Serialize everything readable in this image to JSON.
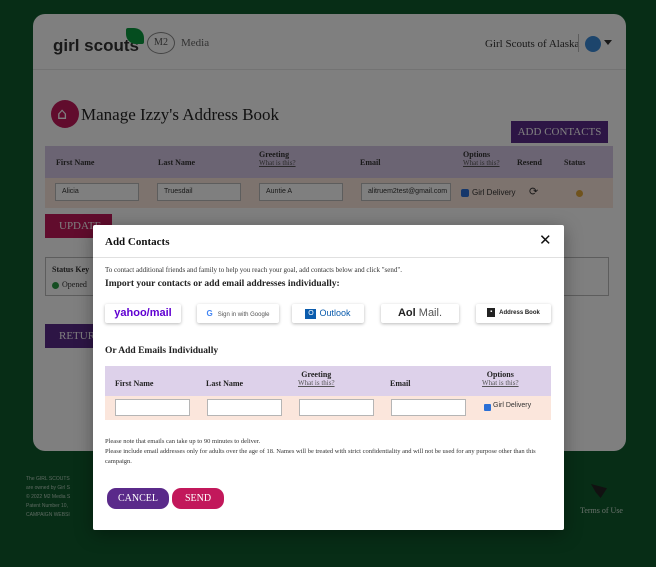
{
  "header": {
    "logo_text": "girl scouts",
    "m2_badge": "M2",
    "m2_label": "Media",
    "council": "Girl Scouts of Alaska"
  },
  "page": {
    "title": "Manage Izzy's Address Book",
    "add_contacts_label": "ADD CONTACTS",
    "update_label": "UPDATE",
    "return_label": "RETURN",
    "status_key_label": "Status Key",
    "status_opened_label": "Opened",
    "columns": {
      "first_name": "First Name",
      "last_name": "Last Name",
      "greeting": "Greeting",
      "greeting_link": "What is this?",
      "email": "Email",
      "options": "Options",
      "options_link": "What is this?",
      "resend": "Resend",
      "status": "Status"
    },
    "row": {
      "first_name": "Alicia",
      "last_name": "Truesdail",
      "greeting": "Auntie A",
      "email": "alitruem2test@gmail.com",
      "option": "Girl Delivery",
      "resend_icon": "refresh-icon",
      "status_color": "#e0a73a"
    }
  },
  "footer": {
    "lines": [
      "The GIRL SCOUTS",
      "are owned by Girl S",
      "© 2022 M2 Media S",
      "Patent Number 10,",
      "CAMPAIGN WEBSI"
    ],
    "terms_label": "Terms of Use"
  },
  "modal": {
    "title": "Add Contacts",
    "close_glyph": "✕",
    "intro": "To contact additional friends and family to help you reach your goal, add contacts below and click \"send\".",
    "import_heading": "Import your contacts or add email addresses individually:",
    "providers": {
      "yahoo": "yahoo/mail",
      "google_g": "G",
      "google": "Sign in with Google",
      "outlook_tile": "O",
      "outlook": "Outlook",
      "aol": "Aol",
      "aol_mail": "Mail.",
      "address_book_tile": "📖",
      "address_book": "Address Book"
    },
    "add_emails_heading": "Or Add Emails Individually",
    "columns": {
      "first_name": "First Name",
      "last_name": "Last Name",
      "greeting": "Greeting",
      "greeting_link": "What is this?",
      "email": "Email",
      "options": "Options",
      "options_link": "What is this?"
    },
    "row": {
      "first_name": "",
      "last_name": "",
      "greeting": "",
      "email": "",
      "option_label": "Girl Delivery",
      "option_checked": true
    },
    "note_1": "Please note that emails can take up to 90 minutes to deliver.",
    "note_2": "Please include email addresses only for adults over the age of 18. Names will be treated with strict confidentiality and will not be used for any purpose other than this campaign.",
    "cancel_label": "CANCEL",
    "send_label": "SEND"
  },
  "colors": {
    "brand_green": "#0f5a2c",
    "purple": "#5a2a8a",
    "magenta": "#c2185b",
    "table_header": "#ddd1ea",
    "row_peach": "#fbe6dc"
  }
}
